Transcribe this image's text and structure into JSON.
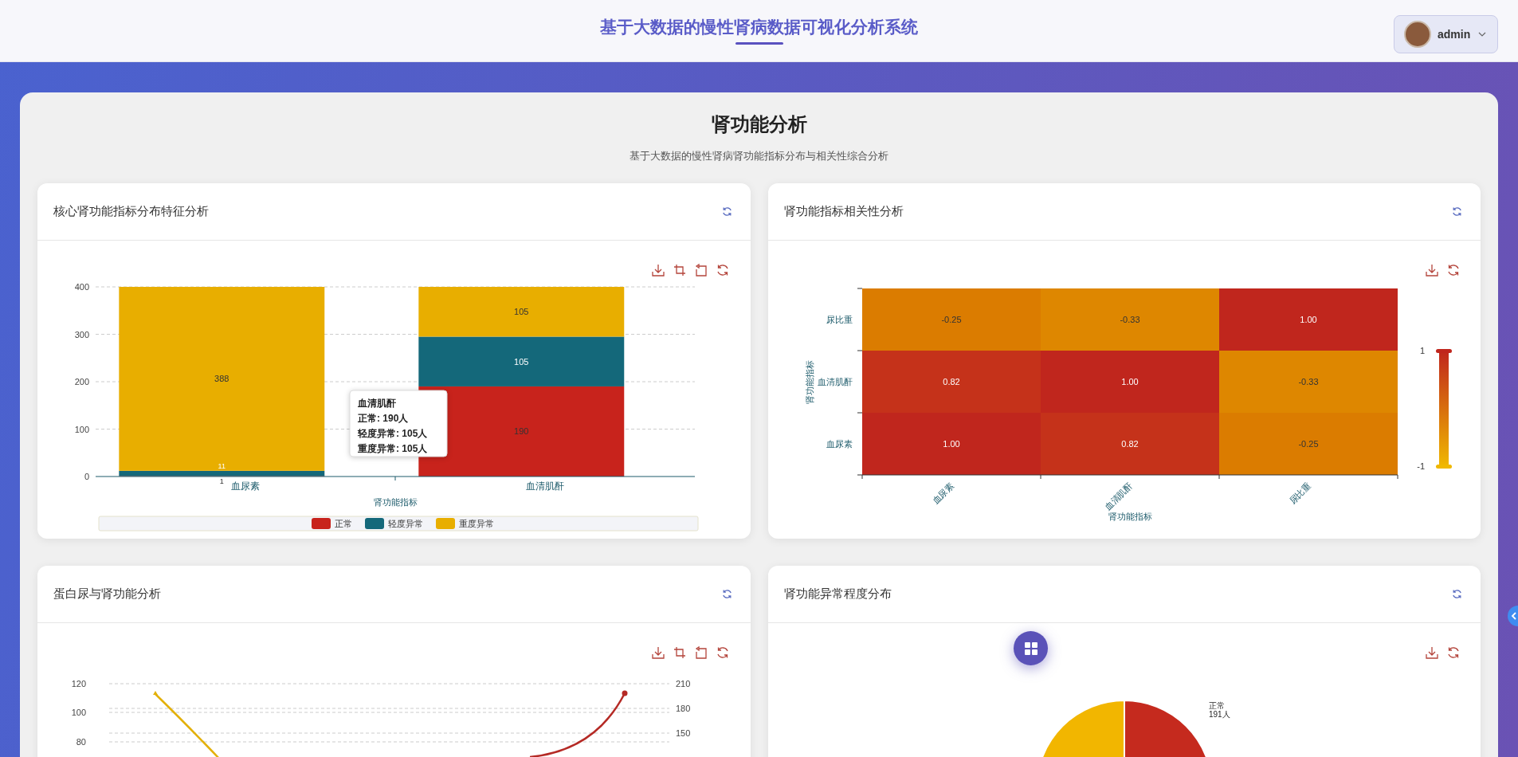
{
  "header": {
    "title": "基于大数据的慢性肾病数据可视化分析系统",
    "user": {
      "name": "admin"
    }
  },
  "page": {
    "title": "肾功能分析",
    "subtitle": "基于大数据的慢性肾病肾功能指标分布与相关性综合分析"
  },
  "cards": [
    {
      "kind": "bar",
      "title": "核心肾功能指标分布特征分析",
      "toolbox": [
        {
          "kind": "download"
        },
        {
          "kind": "zoom"
        },
        {
          "kind": "zoom_back"
        },
        {
          "kind": "restore"
        }
      ],
      "chart_data": {
        "type": "bar",
        "stacked": true,
        "xlabel": "肾功能指标",
        "categories": [
          "血尿素",
          "血清肌酐"
        ],
        "series": [
          {
            "name": "正常",
            "color": "#c8231c",
            "values": [
              1,
              190
            ]
          },
          {
            "name": "轻度异常",
            "color": "#14687a",
            "values": [
              11,
              105
            ]
          },
          {
            "name": "重度异常",
            "color": "#e8ae00",
            "values": [
              388,
              105
            ]
          }
        ],
        "ylim": [
          0,
          400
        ],
        "yticks": [
          0,
          100,
          200,
          300,
          400
        ],
        "data_labels": true,
        "grid": true,
        "legend": "bottom"
      },
      "tooltip": {
        "title": "血清肌酐",
        "lines": [
          "正常: 190人",
          "轻度异常: 105人",
          "重度异常: 105人"
        ]
      }
    },
    {
      "kind": "heatmap",
      "title": "肾功能指标相关性分析",
      "toolbox": [
        {
          "kind": "download"
        },
        {
          "kind": "restore"
        }
      ],
      "heatmap": {
        "ylabel": "肾功能指标",
        "rows": [
          {
            "label": "尿比重",
            "cells": [
              {
                "text": "-0.25",
                "color": "#db7c00"
              },
              {
                "text": "-0.33",
                "color": "#de8700"
              },
              {
                "text": "1.00",
                "color": "#c0261d"
              }
            ]
          },
          {
            "label": "血清肌酐",
            "cells": [
              {
                "text": "0.82",
                "color": "#c5321a"
              },
              {
                "text": "1.00",
                "color": "#c0261d"
              },
              {
                "text": "-0.33",
                "color": "#de8700"
              }
            ]
          },
          {
            "label": "血尿素",
            "cells": [
              {
                "text": "1.00",
                "color": "#c0261d"
              },
              {
                "text": "0.82",
                "color": "#c5321a"
              },
              {
                "text": "-0.25",
                "color": "#db7c00"
              }
            ]
          }
        ],
        "x_axis": {
          "labels": [
            "血尿素",
            "血清肌酐",
            "尿比重"
          ],
          "title": "肾功能指标"
        },
        "scale": {
          "max": "1",
          "min": "-1"
        }
      }
    },
    {
      "kind": "line",
      "title": "蛋白尿与肾功能分析",
      "toolbox": [
        {
          "kind": "download"
        },
        {
          "kind": "zoom"
        },
        {
          "kind": "zoom_back"
        },
        {
          "kind": "restore"
        }
      ],
      "left_ticks": [
        "120",
        "100",
        "80"
      ],
      "right_ticks": [
        "210",
        "180",
        "150"
      ]
    },
    {
      "kind": "pie",
      "title": "肾功能异常程度分布",
      "toolbox": [
        {
          "kind": "download"
        },
        {
          "kind": "restore"
        }
      ],
      "slice_label": {
        "name": "正常",
        "value": "191人"
      }
    }
  ]
}
